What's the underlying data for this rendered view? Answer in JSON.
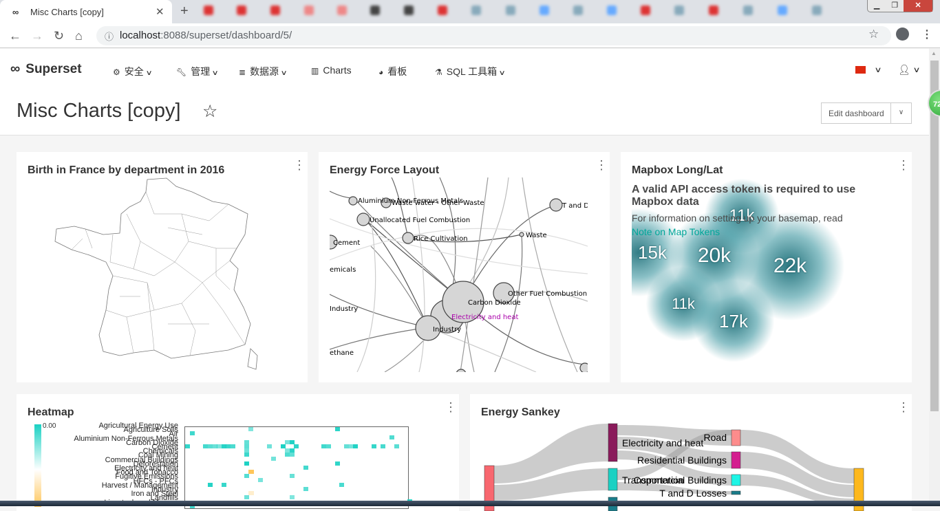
{
  "browser": {
    "tab_title": "Misc Charts [copy]",
    "url_host": "localhost",
    "url_path": ":8088/superset/dashboard/5/",
    "icons": [
      "back-icon",
      "forward-icon",
      "reload-icon",
      "home-icon",
      "info-icon",
      "bookmark-star-icon",
      "account-icon",
      "more-icon"
    ]
  },
  "navbar": {
    "brand": "Superset",
    "menus": [
      {
        "label": "安全",
        "icon": "cogs-icon",
        "dropdown": true
      },
      {
        "label": "管理",
        "icon": "wrench-icon",
        "dropdown": true
      },
      {
        "label": "数据源",
        "icon": "database-icon",
        "dropdown": true
      },
      {
        "label": "Charts",
        "icon": "bar-chart-icon",
        "dropdown": false
      },
      {
        "label": "看板",
        "icon": "dashboard-icon",
        "dropdown": false
      },
      {
        "label": "SQL 工具箱",
        "icon": "flask-icon",
        "dropdown": true
      }
    ],
    "language_flag": "cn-flag-icon",
    "user_icon": "user-icon"
  },
  "dashboard": {
    "title": "Misc Charts [copy]",
    "edit_label": "Edit dashboard"
  },
  "extension_badge": "72",
  "charts": {
    "france": {
      "title": "Birth in France by department in 2016"
    },
    "force": {
      "title": "Energy Force Layout",
      "nodes": [
        "Aluminium Non-Ferrous Metals",
        "Waste water - Other Waste",
        "Unallocated Fuel Combustion",
        "Rice Cultivation",
        "Cement",
        "Waste",
        "T and D",
        "emicals",
        "Carbon Dioxide",
        "Other Fuel Combustion",
        "Electricity and heat",
        "Industry",
        "Industry",
        "ethane"
      ]
    },
    "mapbox": {
      "title": "Mapbox Long/Lat",
      "warning_title": "A valid API access token is required to use Mapbox data",
      "warning_text": "For information on setting up your basemap, read",
      "link": "Note on Map Tokens",
      "clusters": [
        "11k",
        "15k",
        "20k",
        "22k",
        "11k",
        "17k"
      ]
    },
    "heatmap": {
      "title": "Heatmap",
      "legend_value": "0.00",
      "colors": {
        "high": "#1ad1c3",
        "low": "#ffc65a"
      },
      "rows": [
        "Agricultural Energy Use",
        "Agriculture Soils",
        "Air",
        "Aluminium Non-Ferrous Metals",
        "Carbon Dioxide",
        "Cement",
        "Chemicals",
        "Coal Mining",
        "Commercial Buildings",
        "Deforestation",
        "Electricity and heat",
        "Food and Tobacco",
        "Fugitive Emissions",
        "HFCs - PFCs",
        "Harvest / Management",
        "Industry",
        "Iron and Steel",
        "Landfills",
        "Livestock and Manure"
      ]
    },
    "sankey": {
      "title": "Energy Sankey",
      "labels": [
        "Electricity and heat",
        "Transportation",
        "Road",
        "Residential Buildings",
        "Commercial Buildings",
        "T and D Losses"
      ],
      "colors": {
        "source": "#f8676f",
        "electricity": "#8a1a5b",
        "transport": "#1ad1c3",
        "road": "#fd8c8c",
        "residential": "#d41e8f",
        "commercial": "#1ff5e6",
        "tdl": "#1a7c8a",
        "sink": "#fdb81d"
      }
    }
  }
}
